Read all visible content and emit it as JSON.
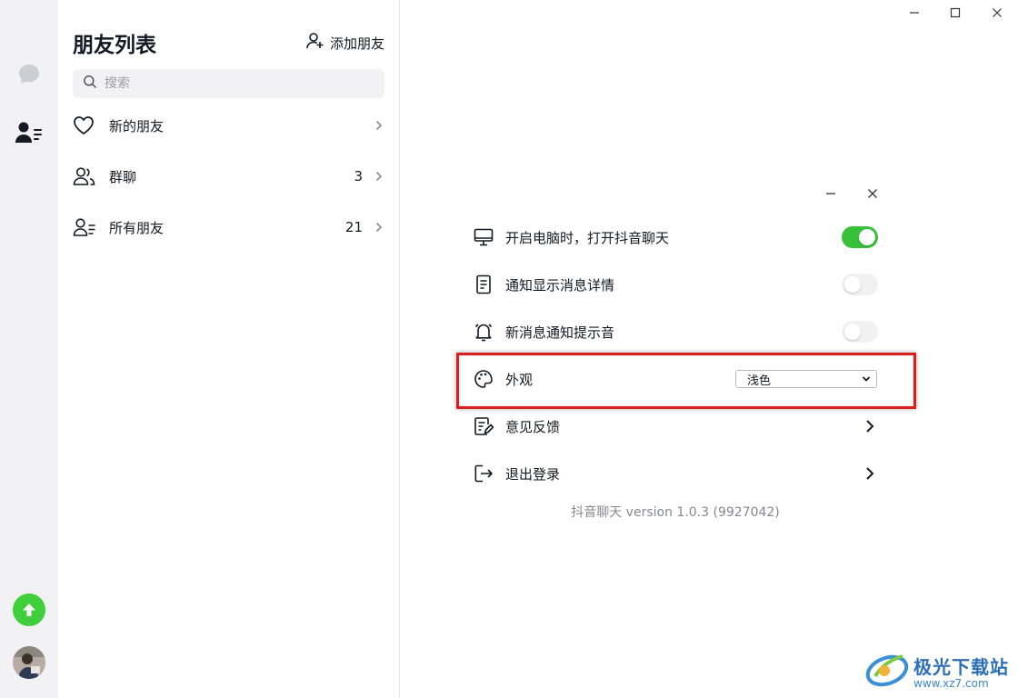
{
  "panel": {
    "title": "朋友列表",
    "add_friend_label": "添加朋友",
    "search_placeholder": "搜索",
    "items": [
      {
        "label": "新的朋友",
        "count": "",
        "icon": "heart-icon"
      },
      {
        "label": "群聊",
        "count": "3",
        "icon": "group-icon"
      },
      {
        "label": "所有朋友",
        "count": "21",
        "icon": "contacts-icon"
      }
    ]
  },
  "rail": {
    "icons": [
      "chat-bubble-icon",
      "contacts-icon",
      "upgrade-arrow-icon",
      "avatar"
    ]
  },
  "settings": {
    "rows": [
      {
        "label": "开启电脑时，打开抖音聊天",
        "icon": "monitor-icon",
        "toggle": true
      },
      {
        "label": "通知显示消息详情",
        "icon": "document-icon",
        "toggle": false
      },
      {
        "label": "新消息通知提示音",
        "icon": "bell-icon",
        "toggle": false
      },
      {
        "label": "外观",
        "icon": "palette-icon",
        "select_value": "浅色"
      },
      {
        "label": "意见反馈",
        "icon": "feedback-icon"
      },
      {
        "label": "退出登录",
        "icon": "logout-icon"
      }
    ],
    "version": "抖音聊天 version 1.0.3 (9927042)"
  },
  "colors": {
    "toggle_on": "#37c13a",
    "highlight": "#d81e1e",
    "upgrade": "#3fcf3b",
    "rail_bg": "#f2f2f4"
  },
  "watermark": {
    "title": "极光下载站",
    "url": "www.xz7.com"
  }
}
